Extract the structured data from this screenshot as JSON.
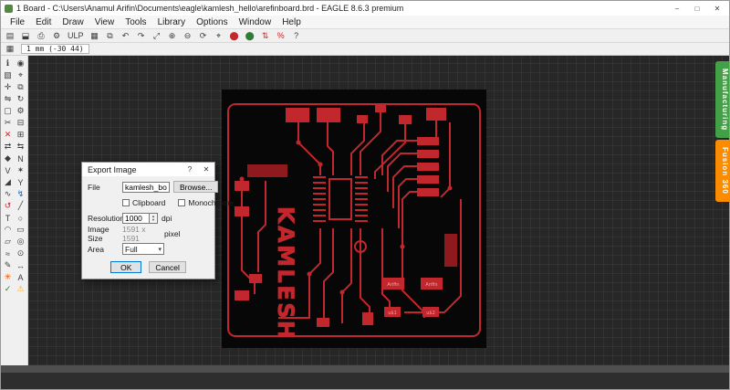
{
  "window": {
    "title": "1 Board - C:\\Users\\Anamul Arifin\\Documents\\eagle\\kamlesh_hello\\arefinboard.brd - EAGLE 8.6.3 premium",
    "minimize": "–",
    "maximize": "□",
    "close": "✕"
  },
  "menu": {
    "items": [
      "File",
      "Edit",
      "Draw",
      "View",
      "Tools",
      "Library",
      "Options",
      "Window",
      "Help"
    ]
  },
  "toolbar": {
    "icons": [
      {
        "name": "open-icon",
        "glyph": "▤"
      },
      {
        "name": "save-icon",
        "glyph": "⬓"
      },
      {
        "name": "print-icon",
        "glyph": "⎙"
      },
      {
        "name": "cam-processor-icon",
        "glyph": "⚙"
      },
      {
        "name": "load-ulp-icon",
        "glyph": "ULP"
      },
      {
        "name": "grid-icon",
        "glyph": "▦"
      },
      {
        "name": "layer-settings-icon",
        "glyph": "⧉"
      },
      {
        "name": "undo-icon",
        "glyph": "↶"
      },
      {
        "name": "redo-icon",
        "glyph": "↷"
      },
      {
        "name": "zoom-fit-icon",
        "glyph": "⤢"
      },
      {
        "name": "zoom-in-icon",
        "glyph": "⊕"
      },
      {
        "name": "zoom-out-icon",
        "glyph": "⊖"
      },
      {
        "name": "zoom-redraw-icon",
        "glyph": "⟳"
      },
      {
        "name": "zoom-select-icon",
        "glyph": "⌖"
      },
      {
        "name": "stop-icon",
        "glyph": "⬤",
        "color": "#c62828"
      },
      {
        "name": "go-icon",
        "glyph": "⬤",
        "color": "#2e7d32"
      },
      {
        "name": "fusion-sync-icon",
        "glyph": "⇅",
        "color": "#c62828"
      },
      {
        "name": "pcb-quote-badge",
        "glyph": "%",
        "color": "#c62828"
      },
      {
        "name": "help-icon",
        "glyph": "?"
      }
    ]
  },
  "coordbar": {
    "icon": "▦",
    "coordinates": "1 mm (-30 44)"
  },
  "sidebar": {
    "tools": [
      {
        "name": "info-tool-icon",
        "glyph": "ℹ"
      },
      {
        "name": "show-tool-icon",
        "glyph": "◉"
      },
      {
        "name": "display-tool-icon",
        "glyph": "▧"
      },
      {
        "name": "mark-tool-icon",
        "glyph": "⌖"
      },
      {
        "name": "move-tool-icon",
        "glyph": "✛"
      },
      {
        "name": "copy-tool-icon",
        "glyph": "⧉"
      },
      {
        "name": "mirror-tool-icon",
        "glyph": "⇋"
      },
      {
        "name": "rotate-tool-icon",
        "glyph": "↻"
      },
      {
        "name": "group-tool-icon",
        "glyph": "▢"
      },
      {
        "name": "change-tool-icon",
        "glyph": "⚙"
      },
      {
        "name": "cut-tool-icon",
        "glyph": "✂"
      },
      {
        "name": "paste-tool-icon",
        "glyph": "⊟"
      },
      {
        "name": "delete-tool-icon",
        "glyph": "✕",
        "color": "#c62828"
      },
      {
        "name": "add-tool-icon",
        "glyph": "⊞"
      },
      {
        "name": "pinswap-tool-icon",
        "glyph": "⇄"
      },
      {
        "name": "replace-tool-icon",
        "glyph": "⇆"
      },
      {
        "name": "lock-tool-icon",
        "glyph": "◆"
      },
      {
        "name": "name-tool-icon",
        "glyph": "N"
      },
      {
        "name": "value-tool-icon",
        "glyph": "V"
      },
      {
        "name": "smash-tool-icon",
        "glyph": "✶"
      },
      {
        "name": "miter-tool-icon",
        "glyph": "◢"
      },
      {
        "name": "split-tool-icon",
        "glyph": "Y"
      },
      {
        "name": "optimize-tool-icon",
        "glyph": "∿"
      },
      {
        "name": "route-tool-icon",
        "glyph": "↯",
        "color": "#1565c0"
      },
      {
        "name": "ripup-tool-icon",
        "glyph": "↺",
        "color": "#c62828"
      },
      {
        "name": "wire-tool-icon",
        "glyph": "╱"
      },
      {
        "name": "text-tool-icon",
        "glyph": "T"
      },
      {
        "name": "circle-tool-icon",
        "glyph": "○"
      },
      {
        "name": "arc-tool-icon",
        "glyph": "◠"
      },
      {
        "name": "rect-tool-icon",
        "glyph": "▭"
      },
      {
        "name": "polygon-tool-icon",
        "glyph": "▱"
      },
      {
        "name": "via-tool-icon",
        "glyph": "◎"
      },
      {
        "name": "signal-tool-icon",
        "glyph": "≈"
      },
      {
        "name": "hole-tool-icon",
        "glyph": "⊙"
      },
      {
        "name": "attribute-tool-icon",
        "glyph": "✎"
      },
      {
        "name": "dimension-tool-icon",
        "glyph": "↔"
      },
      {
        "name": "ratsnest-tool-icon",
        "glyph": "✳",
        "color": "#e65100"
      },
      {
        "name": "auto-tool-icon",
        "glyph": "A"
      },
      {
        "name": "drc-tool-icon",
        "glyph": "✓",
        "color": "#2e7d32"
      },
      {
        "name": "errors-tool-icon",
        "glyph": "⚠",
        "color": "#f9a825"
      }
    ]
  },
  "right_tabs": [
    {
      "name": "manufacturing-tab",
      "label": "Manufacturing",
      "bg": "#43a047"
    },
    {
      "name": "fusion360-tab",
      "label": "Fusion 360",
      "bg": "#fb8c00"
    }
  ],
  "board": {
    "name_text": "KAMLESH",
    "pad_labels": [
      "Arifin",
      "Arifin",
      "u$1",
      "u$2"
    ],
    "copper_color": "#c1272d"
  },
  "dialog": {
    "title": "Export Image",
    "help": "?",
    "close": "✕",
    "file_label": "File",
    "file_value": "kamlesh_board",
    "browse_label": "Browse...",
    "clipboard_label": "Clipboard",
    "monochrome_label": "Monochrome",
    "resolution_label": "Resolution",
    "resolution_value": "1000",
    "resolution_unit": "dpi",
    "image_size_label": "Image Size",
    "image_size_value": "1591 x 1591",
    "image_size_unit": "pixel",
    "area_label": "Area",
    "area_value": "Full",
    "ok_label": "OK",
    "cancel_label": "Cancel"
  }
}
